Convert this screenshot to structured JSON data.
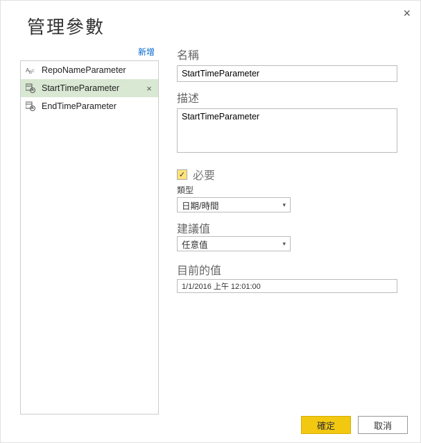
{
  "dialog": {
    "title": "管理參數",
    "new_link": "新增"
  },
  "params": [
    {
      "icon": "text",
      "label": "RepoNameParameter",
      "selected": false
    },
    {
      "icon": "datetime",
      "label": "StartTimeParameter",
      "selected": true
    },
    {
      "icon": "datetime",
      "label": "EndTimeParameter",
      "selected": false
    }
  ],
  "form": {
    "name_label": "名稱",
    "name_value": "StartTimeParameter",
    "desc_label": "描述",
    "desc_value": "StartTimeParameter",
    "required_label": "必要",
    "required_checked": true,
    "type_label": "類型",
    "type_value": "日期/時間",
    "suggested_label": "建議值",
    "suggested_value": "任意值",
    "current_label": "目前的值",
    "current_value": "1/1/2016 上午 12:01:00"
  },
  "buttons": {
    "ok": "確定",
    "cancel": "取消"
  }
}
